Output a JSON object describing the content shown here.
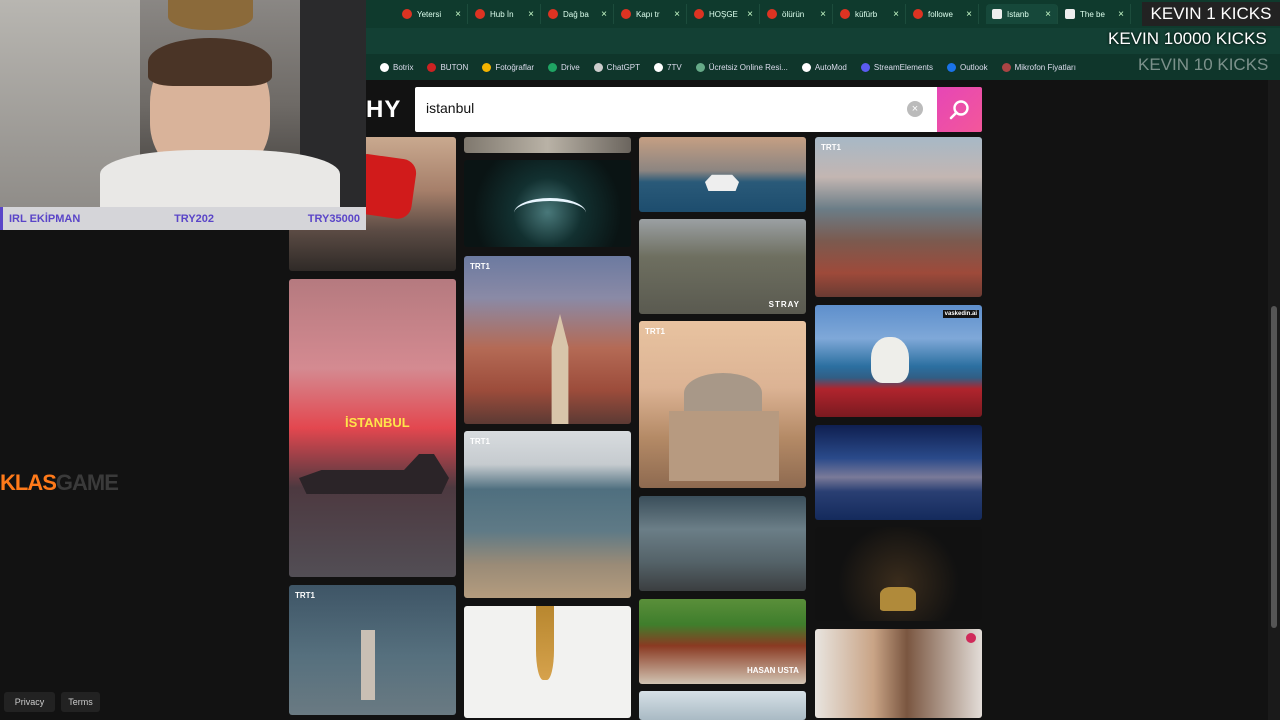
{
  "tabs": [
    {
      "title": "Yetersi"
    },
    {
      "title": "Hub İn"
    },
    {
      "title": "Dağ ba"
    },
    {
      "title": "Kapı tr"
    },
    {
      "title": "HOŞGE"
    },
    {
      "title": "ölürün"
    },
    {
      "title": "küfürb"
    },
    {
      "title": "followe"
    },
    {
      "title": "Istanb"
    },
    {
      "title": "The be"
    }
  ],
  "bookmarks": [
    "Botrix",
    "BUTON",
    "Fotoğraflar",
    "Drive",
    "ChatGPT",
    "7TV",
    "Ücretsiz Online Resi...",
    "AutoMod",
    "StreamElements",
    "Outlook",
    "Mikrofon Fiyatları"
  ],
  "site": {
    "logo": "HY"
  },
  "search": {
    "value": "istanbul",
    "clear_icon": "×"
  },
  "gifs": {
    "istanbul_text": "İSTANBUL",
    "stray_text": "STRAY",
    "trt_badge": "TRT1",
    "hasan_usta": "HASAN USTA",
    "watermark": "vaskedin.ai"
  },
  "webcam_bar": {
    "left": "IRL EKİPMAN",
    "mid": "TRY202",
    "right": "TRY35000"
  },
  "overlay": {
    "kicks1": "KEVIN 1 KICKS",
    "kicks2": "KEVIN 10000 KICKS",
    "kicks3": "KEVIN 10 KICKS",
    "klas_a": "KLAS",
    "klas_b": "GAME"
  },
  "footer": {
    "privacy": "Privacy",
    "terms": "Terms"
  }
}
